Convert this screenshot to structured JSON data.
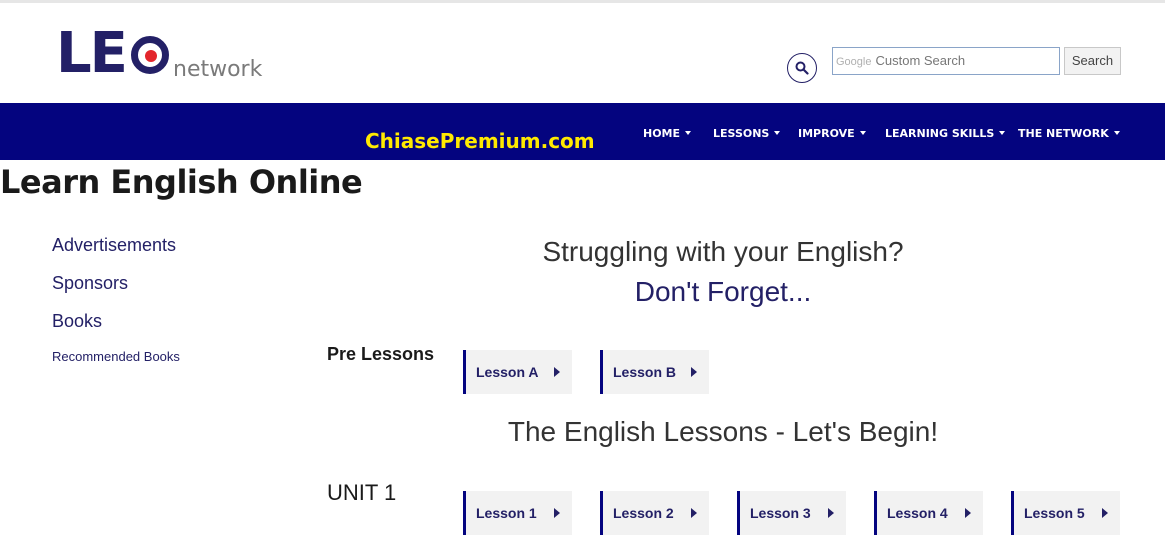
{
  "header": {
    "logo": {
      "main": "LEO",
      "sub": "network"
    },
    "search": {
      "placeholder": "Custom Search",
      "provider": "Google",
      "button": "Search"
    }
  },
  "nav": {
    "brand": "ChiasePremium.com",
    "items": [
      {
        "label": "HOME"
      },
      {
        "label": "LESSONS"
      },
      {
        "label": "IMPROVE"
      },
      {
        "label": "LEARNING SKILLS"
      },
      {
        "label": "THE NETWORK"
      }
    ]
  },
  "page_title": "Learn English Online",
  "sidebar": {
    "links": [
      {
        "label": "Advertisements"
      },
      {
        "label": "Sponsors"
      },
      {
        "label": "Books"
      }
    ],
    "small_link": "Recommended Books"
  },
  "main": {
    "headline1": "Struggling with your English?",
    "headline2": "Don't Forget...",
    "pre_lessons": {
      "label": "Pre Lessons",
      "buttons": [
        "Lesson A",
        "Lesson B"
      ]
    },
    "headline3": "The English Lessons - Let's Begin!",
    "unit1": {
      "label": "UNIT 1",
      "buttons": [
        "Lesson 1",
        "Lesson 2",
        "Lesson 3",
        "Lesson 4",
        "Lesson 5"
      ]
    }
  },
  "colors": {
    "navy": "#04047f",
    "brand_yellow": "#ffea00",
    "logo_red": "#e3262c"
  }
}
